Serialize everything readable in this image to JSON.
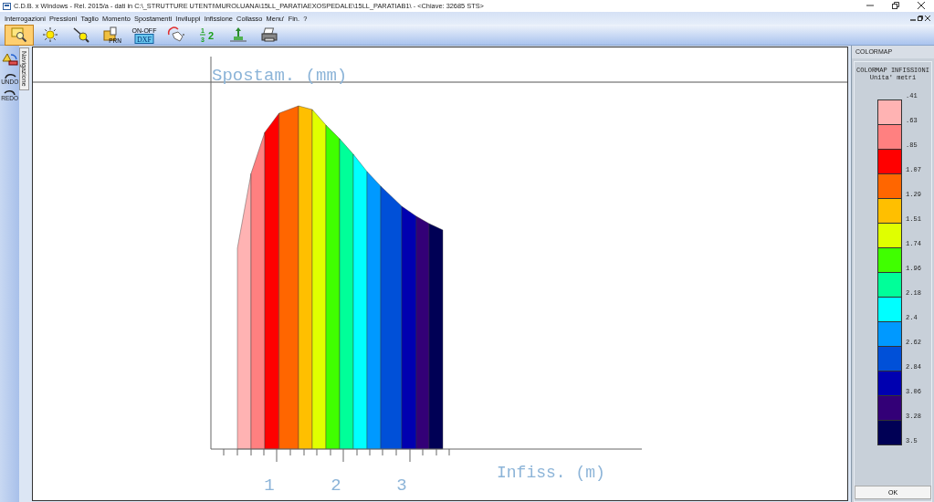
{
  "window": {
    "title": "C.D.B. x Windows - Rel. 2015/a - dati in C:\\_STRUTTURE UTENTI\\MUROLUANA\\15LL_PARATIAEXOSPEDALE\\15LL_PARATIAB1\\ - <Chiave: 32685 STS>"
  },
  "menu": [
    "Interrogazioni",
    "Pressioni",
    "Taglio",
    "Momento",
    "Spostamenti",
    "Inviluppi",
    "Infissione",
    "Collasso",
    "Menu'",
    "Fin.",
    "?"
  ],
  "toolbar": [
    {
      "kind": "zoom",
      "selected": true
    },
    {
      "kind": "sun",
      "selected": false
    },
    {
      "kind": "wand",
      "selected": false
    },
    {
      "kind": "folder",
      "selected": false,
      "texts": [
        "PRN"
      ]
    },
    {
      "kind": "dxf",
      "selected": false,
      "texts": [
        "ON-OFF",
        "DXF"
      ]
    },
    {
      "kind": "hands",
      "selected": false
    },
    {
      "kind": "numbers",
      "selected": false,
      "texts": [
        "1",
        "3",
        "2"
      ]
    },
    {
      "kind": "wall",
      "selected": false
    },
    {
      "kind": "printer",
      "selected": false
    }
  ],
  "side_tools": [
    {
      "kind": "pick"
    },
    {
      "kind": "undo",
      "label": "UNDO"
    },
    {
      "kind": "redo",
      "label": "REDO"
    }
  ],
  "navigation_tab": "Navigazione",
  "plot": {
    "y_label": "Spostam. (mm)",
    "x_label": "Infiss. (m)",
    "x_tick_labels": [
      "1",
      "2",
      "3"
    ]
  },
  "colormap": {
    "title": "COLORMAP",
    "heading": "COLORMAP INFISSIONI",
    "units": "Unita' metri",
    "labels": [
      ".41",
      ".63",
      ".85",
      "1.07",
      "1.29",
      "1.51",
      "1.74",
      "1.96",
      "2.18",
      "2.4",
      "2.62",
      "2.84",
      "3.06",
      "3.28",
      "3.5"
    ],
    "bands": [
      {
        "color": "#ffb3b3"
      },
      {
        "color": "#ff8080"
      },
      {
        "color": "#ff0000"
      },
      {
        "color": "#ff6600"
      },
      {
        "color": "#ffbf00"
      },
      {
        "color": "#e0ff00"
      },
      {
        "color": "#40ff00"
      },
      {
        "color": "#00ff99"
      },
      {
        "color": "#00ffff"
      },
      {
        "color": "#0099ff"
      },
      {
        "color": "#0050d8"
      },
      {
        "color": "#0000b0"
      },
      {
        "color": "#330077"
      },
      {
        "color": "#000055"
      }
    ],
    "ok_button": "OK"
  }
}
